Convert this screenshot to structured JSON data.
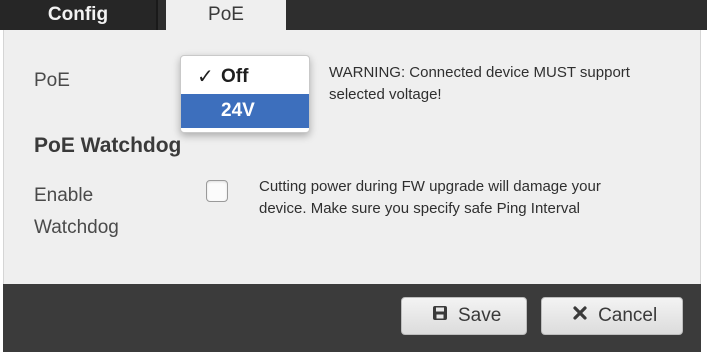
{
  "tabs": [
    {
      "label": "Config",
      "active": false
    },
    {
      "label": "PoE",
      "active": true
    }
  ],
  "poe": {
    "label": "PoE",
    "options": [
      {
        "label": "Off",
        "checked": true
      },
      {
        "label": "24V",
        "highlighted": true
      }
    ],
    "warning": "WARNING: Connected device MUST support selected voltage!"
  },
  "watchdog": {
    "section_title": "PoE Watchdog",
    "enable_label_line1": "Enable",
    "enable_label_line2": "Watchdog",
    "checked": false,
    "note": "Cutting power during FW upgrade will damage your device. Make sure you specify safe Ping Interval"
  },
  "actions": {
    "save_label": "Save",
    "cancel_label": "Cancel"
  },
  "icons": {
    "check": "check-icon",
    "save": "floppy-disk-icon",
    "cancel": "close-x-icon"
  },
  "colors": {
    "highlight": "#3d6fbd",
    "panel_bg": "#efefef",
    "bar_bg": "#3b3b3b"
  }
}
